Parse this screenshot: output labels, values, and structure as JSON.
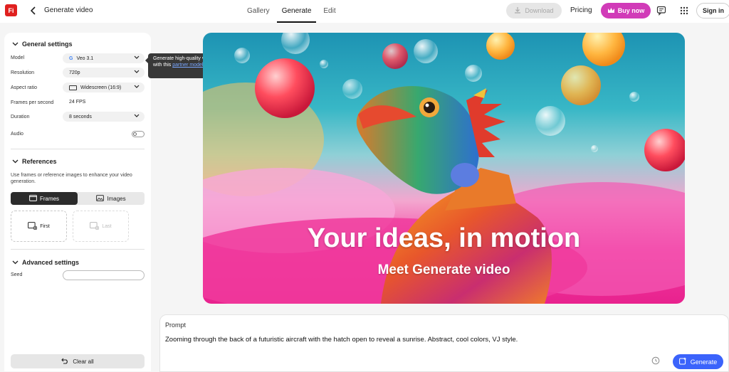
{
  "app": {
    "logo_text": "Fi",
    "title": "Generate video"
  },
  "nav": {
    "tabs": [
      {
        "label": "Gallery"
      },
      {
        "label": "Generate"
      },
      {
        "label": "Edit"
      }
    ],
    "active": "Generate"
  },
  "header": {
    "download_label": "Download",
    "pricing_label": "Pricing",
    "buy_label": "Buy now",
    "signin_label": "Sign in"
  },
  "settings": {
    "general_title": "General settings",
    "model": {
      "label": "Model",
      "value": "Veo 3.1"
    },
    "resolution": {
      "label": "Resolution",
      "value": "720p"
    },
    "aspect": {
      "label": "Aspect ratio",
      "value": "Widescreen (16:9)"
    },
    "fps": {
      "label": "Frames per second",
      "value": "24 FPS"
    },
    "duration": {
      "label": "Duration",
      "value": "8 seconds"
    },
    "audio": {
      "label": "Audio",
      "enabled": false
    }
  },
  "tooltip": {
    "text": "Generate high-quality videos with this",
    "link": "partner model",
    "suffix": "."
  },
  "references": {
    "title": "References",
    "hint": "Use frames or reference images to enhance your video generation.",
    "tabs": {
      "frames": "Frames",
      "images": "Images",
      "active": "Frames"
    },
    "first_label": "First",
    "last_label": "Last"
  },
  "advanced": {
    "title": "Advanced settings",
    "seed_label": "Seed",
    "seed_value": ""
  },
  "clear_label": "Clear all",
  "hero": {
    "title": "Your ideas, in motion",
    "subtitle": "Meet Generate video"
  },
  "prompt": {
    "label": "Prompt",
    "text": "Zooming through the back of a futuristic aircraft with the hatch open to reveal a sunrise. Abstract, cool colors, VJ style.",
    "generate_label": "Generate"
  },
  "colors": {
    "accent": "#3b63fb",
    "buy": "#d13bb8",
    "brand": "#e0201f"
  }
}
